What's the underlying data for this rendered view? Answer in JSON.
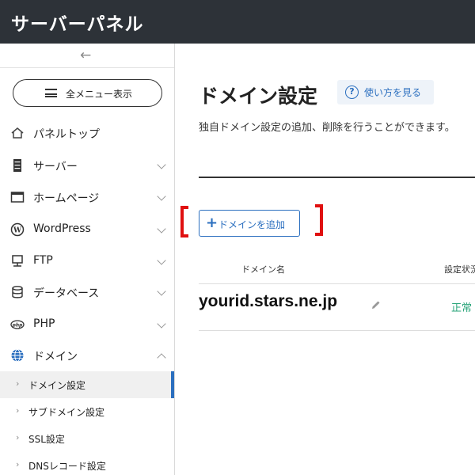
{
  "header": {
    "title": "サーバーパネル"
  },
  "sidebar": {
    "all_menu_label": "全メニュー表示",
    "items": [
      {
        "label": "パネルトップ",
        "icon": "home-icon"
      },
      {
        "label": "サーバー",
        "icon": "server-icon"
      },
      {
        "label": "ホームページ",
        "icon": "browser-window-icon"
      },
      {
        "label": "WordPress",
        "icon": "wordpress-icon"
      },
      {
        "label": "FTP",
        "icon": "ftp-monitor-icon"
      },
      {
        "label": "データベース",
        "icon": "database-icon"
      },
      {
        "label": "PHP",
        "icon": "php-icon"
      },
      {
        "label": "ドメイン",
        "icon": "globe-icon"
      }
    ],
    "sub_items": [
      {
        "label": "ドメイン設定",
        "active": true
      },
      {
        "label": "サブドメイン設定"
      },
      {
        "label": "SSL設定"
      },
      {
        "label": "DNSレコード設定"
      }
    ]
  },
  "main": {
    "title": "ドメイン設定",
    "help_label": "使い方を見る",
    "description": "独自ドメイン設定の追加、削除を行うことができます。",
    "add_button_label": "ドメインを追加",
    "table": {
      "headers": {
        "domain": "ドメイン名",
        "status": "設定状況"
      },
      "rows": [
        {
          "domain": "yourid.stars.ne.jp",
          "status": "正常"
        }
      ]
    }
  },
  "colors": {
    "accent": "#2b6fbf",
    "topbar": "#2d3238",
    "status_ok": "#2aa57a",
    "highlight": "#e01010"
  }
}
